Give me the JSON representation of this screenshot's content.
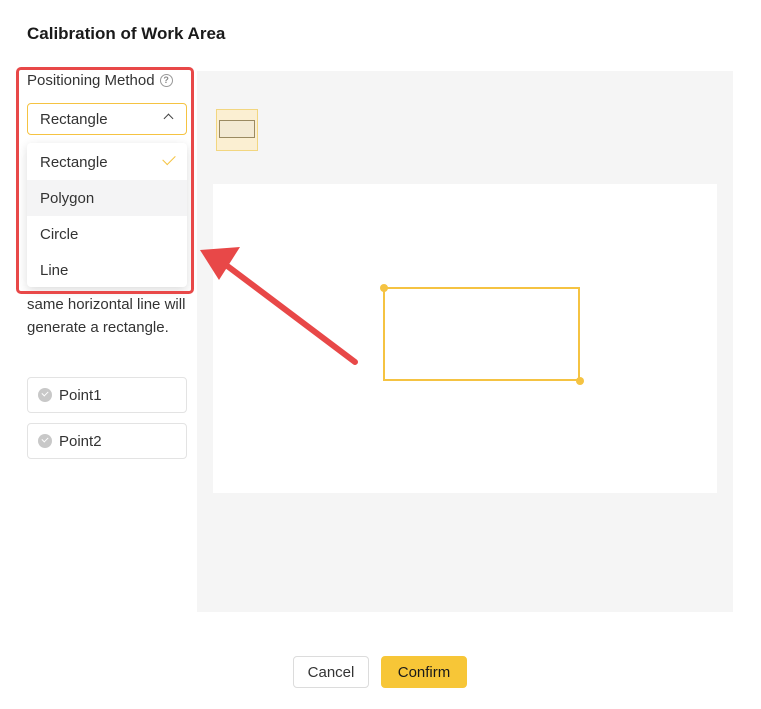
{
  "dialog": {
    "title": "Calibration of Work Area"
  },
  "positioning": {
    "label": "Positioning Method",
    "selected": "Rectangle",
    "options": [
      "Rectangle",
      "Polygon",
      "Circle",
      "Line"
    ],
    "hovered_option": "Polygon",
    "description": "same horizontal line will generate a rectangle."
  },
  "points": [
    "Point1",
    "Point2"
  ],
  "buttons": {
    "cancel": "Cancel",
    "confirm": "Confirm"
  },
  "icons": {
    "help": "question-circle-icon",
    "chevron": "chevron-up-icon",
    "check": "check-icon",
    "point": "check-circle-icon"
  },
  "colors": {
    "accent": "#f7c637",
    "annotation": "#e84848"
  }
}
